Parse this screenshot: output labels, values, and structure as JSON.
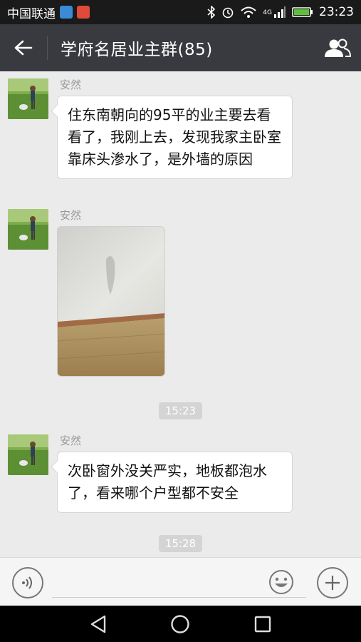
{
  "status_bar": {
    "carrier": "中国联通",
    "network": "4G",
    "time": "23:23"
  },
  "header": {
    "title": "学府名居业主群(85)"
  },
  "messages": [
    {
      "sender": "安然",
      "text": "住东南朝向的95平的业主要去看看了，我刚上去，发现我家主卧室靠床头渗水了，是外墙的原因"
    },
    {
      "sender": "安然",
      "type": "image"
    },
    {
      "sender": "安然",
      "text": "次卧窗外没关严实，地板都泡水了，看来哪个户型都不安全"
    }
  ],
  "timestamps": [
    "15:23",
    "15:28"
  ],
  "colors": {
    "title_bar": "#393a3f",
    "chat_bg": "#ebebeb",
    "status_bar": "#1a1a1a"
  }
}
